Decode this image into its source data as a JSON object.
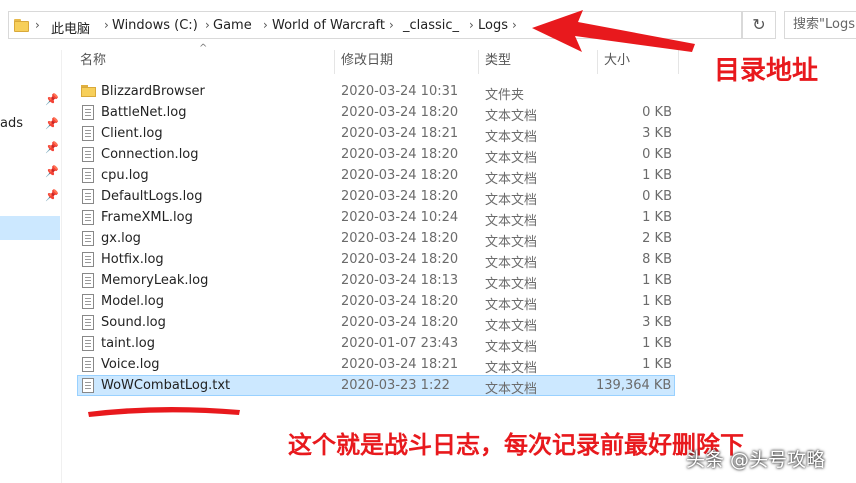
{
  "address": {
    "crumbs": [
      "此电脑",
      "Windows (C:)",
      "Game",
      "World of Warcraft",
      "_classic_",
      "Logs"
    ],
    "search_placeholder": "搜索\"Logs\"",
    "refresh_icon": "refresh-icon"
  },
  "sidebar": {
    "partial_label": "ads",
    "pin_icon": "pin-icon"
  },
  "columns": {
    "name": "名称",
    "date": "修改日期",
    "type": "类型",
    "size": "大小"
  },
  "files": [
    {
      "name": "BlizzardBrowser",
      "date": "2020-03-24 10:31",
      "type": "文件夹",
      "size": "",
      "kind": "folder"
    },
    {
      "name": "BattleNet.log",
      "date": "2020-03-24 18:20",
      "type": "文本文档",
      "size": "0 KB",
      "kind": "doc"
    },
    {
      "name": "Client.log",
      "date": "2020-03-24 18:21",
      "type": "文本文档",
      "size": "3 KB",
      "kind": "doc"
    },
    {
      "name": "Connection.log",
      "date": "2020-03-24 18:20",
      "type": "文本文档",
      "size": "0 KB",
      "kind": "doc"
    },
    {
      "name": "cpu.log",
      "date": "2020-03-24 18:20",
      "type": "文本文档",
      "size": "1 KB",
      "kind": "doc"
    },
    {
      "name": "DefaultLogs.log",
      "date": "2020-03-24 18:20",
      "type": "文本文档",
      "size": "0 KB",
      "kind": "doc"
    },
    {
      "name": "FrameXML.log",
      "date": "2020-03-24 10:24",
      "type": "文本文档",
      "size": "1 KB",
      "kind": "doc"
    },
    {
      "name": "gx.log",
      "date": "2020-03-24 18:20",
      "type": "文本文档",
      "size": "2 KB",
      "kind": "doc"
    },
    {
      "name": "Hotfix.log",
      "date": "2020-03-24 18:20",
      "type": "文本文档",
      "size": "8 KB",
      "kind": "doc"
    },
    {
      "name": "MemoryLeak.log",
      "date": "2020-03-24 18:13",
      "type": "文本文档",
      "size": "1 KB",
      "kind": "doc"
    },
    {
      "name": "Model.log",
      "date": "2020-03-24 18:20",
      "type": "文本文档",
      "size": "1 KB",
      "kind": "doc"
    },
    {
      "name": "Sound.log",
      "date": "2020-03-24 18:20",
      "type": "文本文档",
      "size": "3 KB",
      "kind": "doc"
    },
    {
      "name": "taint.log",
      "date": "2020-01-07 23:43",
      "type": "文本文档",
      "size": "1 KB",
      "kind": "doc"
    },
    {
      "name": "Voice.log",
      "date": "2020-03-24 18:21",
      "type": "文本文档",
      "size": "1 KB",
      "kind": "doc"
    },
    {
      "name": "WoWCombatLog.txt",
      "date": "2020-03-23 1:22",
      "type": "文本文档",
      "size": "139,364 KB",
      "kind": "doc",
      "selected": true
    }
  ],
  "annotations": {
    "address_note": "目录地址",
    "bottom_note": "这个就是战斗日志，每次记录前最好删除下",
    "watermark": "头条 @头号攻略",
    "accent_color": "#e8191d",
    "selection_color": "#cce8ff"
  }
}
